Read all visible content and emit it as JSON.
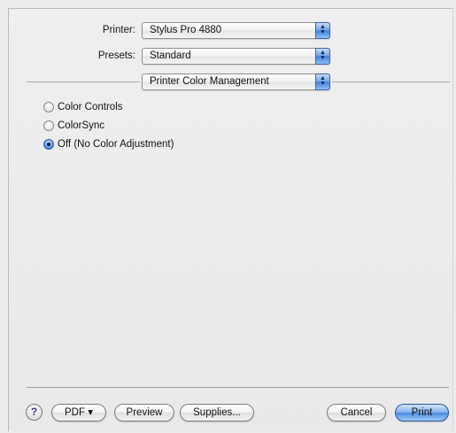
{
  "printer": {
    "label": "Printer:",
    "value": "Stylus Pro 4880"
  },
  "presets": {
    "label": "Presets:",
    "value": "Standard"
  },
  "section_popup": {
    "value": "Printer Color Management"
  },
  "options": [
    {
      "label": "Color Controls",
      "selected": false
    },
    {
      "label": "ColorSync",
      "selected": false
    },
    {
      "label": "Off (No Color Adjustment)",
      "selected": true
    }
  ],
  "buttons": {
    "help": "?",
    "pdf": "PDF ▾",
    "preview": "Preview",
    "supplies": "Supplies...",
    "cancel": "Cancel",
    "print": "Print"
  },
  "colors": {
    "accent": "#4a8be0",
    "window_bg": "#ececec"
  },
  "icons": {
    "popup_arrows": "up-down-arrows-icon",
    "help": "question-mark-icon"
  }
}
